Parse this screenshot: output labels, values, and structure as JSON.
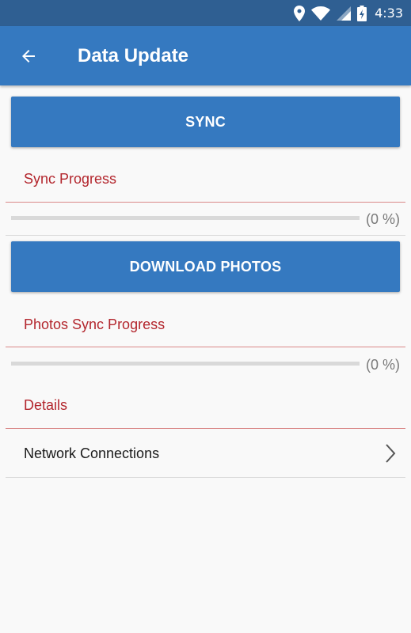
{
  "status_bar": {
    "time": "4:33"
  },
  "app_bar": {
    "title": "Data Update"
  },
  "sync": {
    "button_label": "SYNC",
    "progress_label": "Sync Progress",
    "progress_value": 0,
    "progress_text": "(0 %)"
  },
  "photos": {
    "button_label": "DOWNLOAD PHOTOS",
    "progress_label": "Photos Sync Progress",
    "progress_value": 0,
    "progress_text": "(0 %)"
  },
  "details": {
    "label": "Details",
    "items": [
      {
        "label": "Network Connections"
      }
    ]
  },
  "colors": {
    "primary": "#3579c0",
    "status_bar": "#2f5f92",
    "accent_red": "#b3262d"
  }
}
